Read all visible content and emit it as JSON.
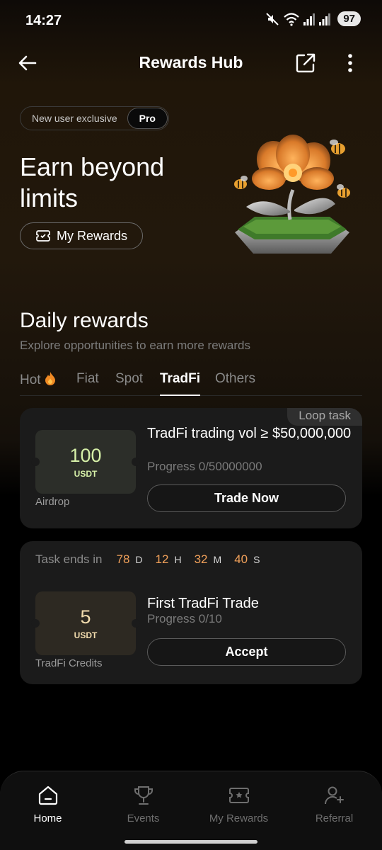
{
  "status_bar": {
    "time": "14:27",
    "battery": "97"
  },
  "header": {
    "title": "Rewards Hub"
  },
  "hero": {
    "segment_left": "New user exclusive",
    "segment_right": "Pro",
    "title": "Earn beyond limits",
    "my_rewards_label": "My Rewards"
  },
  "daily": {
    "title": "Daily rewards",
    "subtitle": "Explore opportunities to earn more rewards",
    "tabs": [
      {
        "label": "Hot",
        "icon": "fire-icon"
      },
      {
        "label": "Fiat"
      },
      {
        "label": "Spot"
      },
      {
        "label": "TradFi",
        "active": true
      },
      {
        "label": "Others"
      }
    ]
  },
  "tasks": [
    {
      "tag": "Loop task",
      "reward_value": "100",
      "reward_unit": "USDT",
      "reward_type": "Airdrop",
      "title": "TradFi trading vol ≥ $50,000,000",
      "progress": "Progress 0/50000000",
      "button": "Trade Now"
    },
    {
      "countdown_label": "Task ends in",
      "countdown": {
        "d": "78",
        "d_unit": "D",
        "h": "12",
        "h_unit": "H",
        "m": "32",
        "m_unit": "M",
        "s": "40",
        "s_unit": "S"
      },
      "reward_value": "5",
      "reward_unit": "USDT",
      "reward_type": "TradFi Credits",
      "title": "First TradFi Trade",
      "progress": "Progress 0/10",
      "button": "Accept"
    }
  ],
  "bottom_nav": [
    {
      "label": "Home",
      "icon": "home-icon",
      "active": true
    },
    {
      "label": "Events",
      "icon": "trophy-icon"
    },
    {
      "label": "My Rewards",
      "icon": "ticket-icon"
    },
    {
      "label": "Referral",
      "icon": "referral-icon"
    }
  ],
  "colors": {
    "accent_orange": "#f0a05a",
    "ticket_green_text": "#d6f0a8",
    "ticket_gold_text": "#f2dcae",
    "card_bg": "#1b1b1b"
  }
}
